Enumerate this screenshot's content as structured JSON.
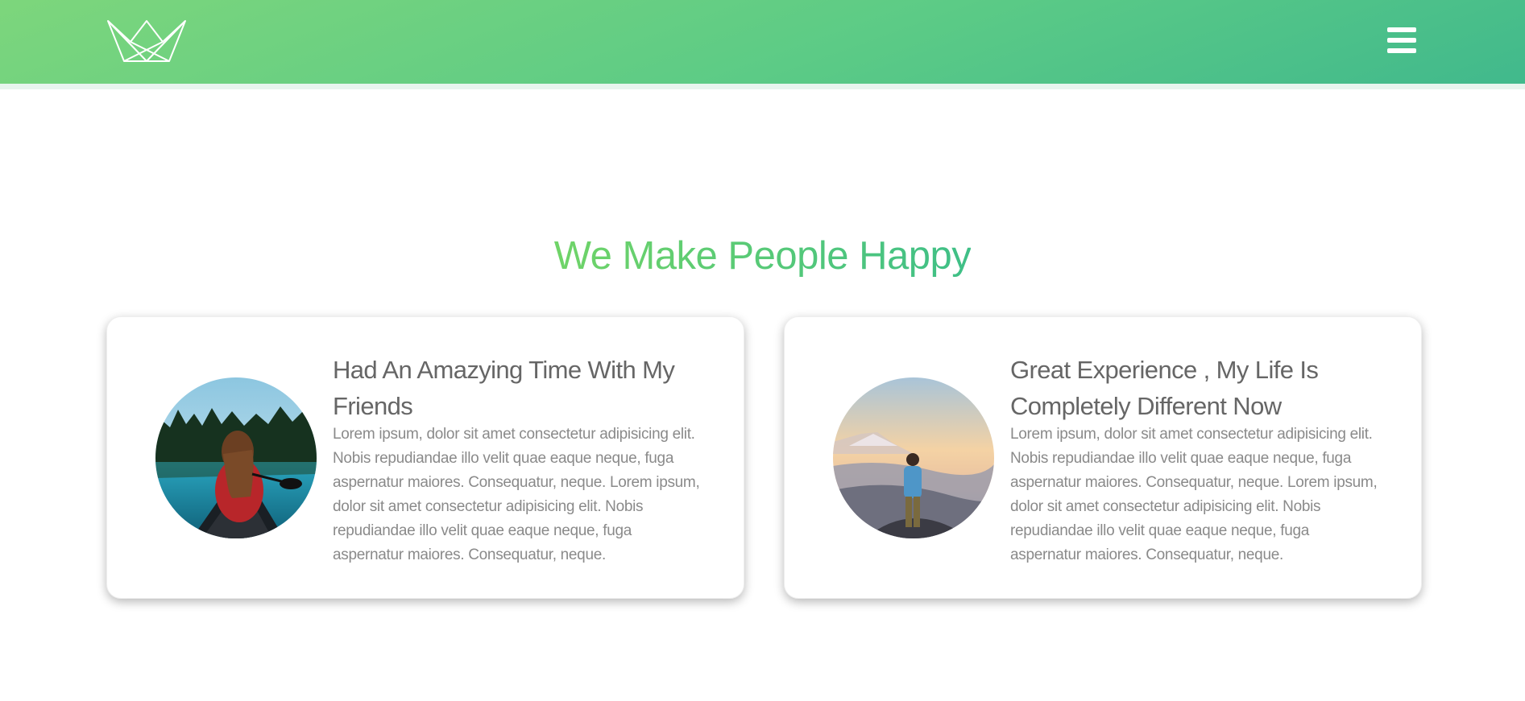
{
  "header": {
    "logo_name": "crown-logo",
    "menu_icon": "hamburger-menu-icon",
    "gradient_start": "#7dd67c",
    "gradient_end": "#41b98c"
  },
  "section": {
    "title": "We Make People Happy"
  },
  "testimonials": [
    {
      "heading": "Had An Amazying Time With My Friends",
      "body": "Lorem ipsum, dolor sit amet consectetur adipisicing elit. Nobis repudiandae illo velit quae eaque neque, fuga aspernatur maiores. Consequatur, neque. Lorem ipsum, dolor sit amet consectetur adipisicing elit. Nobis repudiandae illo velit quae eaque neque, fuga aspernatur maiores. Consequatur, neque.",
      "photo": "woman-in-canoe-photo"
    },
    {
      "heading": "Great Experience , My Life Is Completely Different Now",
      "body": "Lorem ipsum, dolor sit amet consectetur adipisicing elit. Nobis repudiandae illo velit quae eaque neque, fuga aspernatur maiores. Consequatur, neque. Lorem ipsum, dolor sit amet consectetur adipisicing elit. Nobis repudiandae illo velit quae eaque neque, fuga aspernatur maiores. Consequatur, neque.",
      "photo": "man-on-mountain-photo"
    }
  ]
}
